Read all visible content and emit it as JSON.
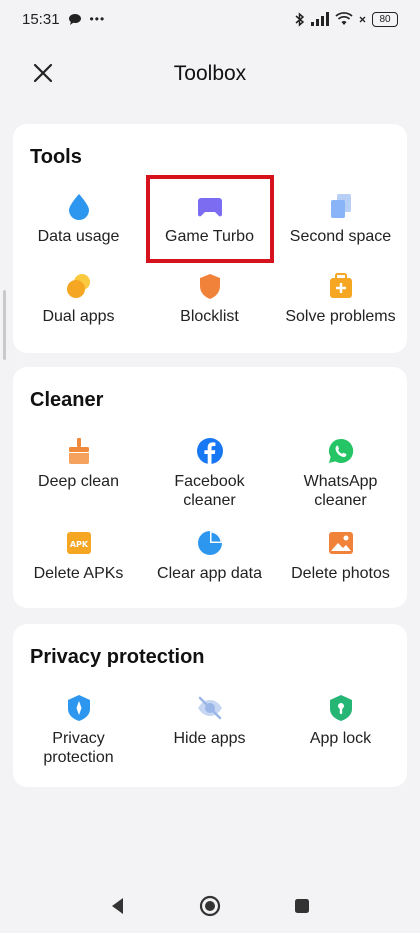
{
  "status_bar": {
    "time": "15:31",
    "battery": "80",
    "more": "•••"
  },
  "header": {
    "title": "Toolbox"
  },
  "sections": [
    {
      "title": "Tools",
      "items": [
        {
          "label": "Data usage",
          "icon": "water-drop-icon",
          "color": "#2d97f0"
        },
        {
          "label": "Game Turbo",
          "icon": "gamepad-icon",
          "color": "#7c6cf2"
        },
        {
          "label": "Second space",
          "icon": "layers-icon",
          "color": "#8ab4f8"
        },
        {
          "label": "Dual apps",
          "icon": "dual-circles-icon",
          "color": "#f5a623"
        },
        {
          "label": "Blocklist",
          "icon": "shield-icon",
          "color": "#f0823a"
        },
        {
          "label": "Solve problems",
          "icon": "first-aid-icon",
          "color": "#f5a623"
        }
      ]
    },
    {
      "title": "Cleaner",
      "items": [
        {
          "label": "Deep clean",
          "icon": "broom-icon",
          "color": "#f08a3c"
        },
        {
          "label": "Facebook cleaner",
          "label_lines": [
            "Facebook",
            "cleaner"
          ],
          "icon": "facebook-icon",
          "color": "#1877f2"
        },
        {
          "label": "WhatsApp cleaner",
          "label_lines": [
            "WhatsApp",
            "cleaner"
          ],
          "icon": "whatsapp-icon",
          "color": "#25c464"
        },
        {
          "label": "Delete APKs",
          "icon": "apk-icon",
          "icon_text": "APK",
          "color": "#f5a623"
        },
        {
          "label": "Clear app data",
          "icon": "pie-chart-icon",
          "color": "#2d97f0"
        },
        {
          "label": "Delete photos",
          "icon": "photo-icon",
          "color": "#f0823a"
        }
      ]
    },
    {
      "title": "Privacy protection",
      "items": [
        {
          "label": "Privacy protection",
          "label_lines": [
            "Privacy",
            "protection"
          ],
          "icon": "privacy-shield-icon",
          "color": "#2d97f0"
        },
        {
          "label": "Hide apps",
          "icon": "eye-off-icon",
          "color": "#9bb7e8"
        },
        {
          "label": "App lock",
          "icon": "lock-shield-icon",
          "color": "#25b574"
        }
      ]
    }
  ]
}
